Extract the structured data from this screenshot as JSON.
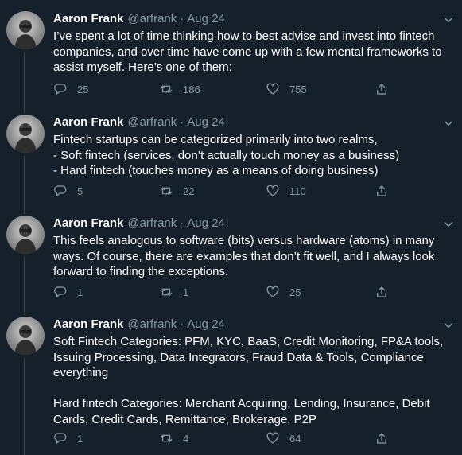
{
  "colors": {
    "background": "#15202b",
    "text": "#ffffff",
    "secondary": "#8899a6",
    "thread_line": "#38444d"
  },
  "tweets": [
    {
      "name": "Aaron Frank",
      "handle": "@arfrank",
      "separator": "·",
      "date": "Aug 24",
      "text": "I’ve spent a lot of time thinking how to best advise and invest into fintech companies, and over time have come up with a few mental frameworks to assist myself.  Here’s one of them:",
      "replies": "25",
      "retweets": "186",
      "likes": "755",
      "icons": [
        "avatar",
        "chevron-down-icon",
        "reply-icon",
        "retweet-icon",
        "like-icon",
        "share-icon"
      ]
    },
    {
      "name": "Aaron Frank",
      "handle": "@arfrank",
      "separator": "·",
      "date": "Aug 24",
      "text": "Fintech startups can be categorized primarily into two realms,\n- Soft fintech (services, don’t actually touch money as a business)\n- Hard fintech (touches money as a means of doing business)",
      "replies": "5",
      "retweets": "22",
      "likes": "110"
    },
    {
      "name": "Aaron Frank",
      "handle": "@arfrank",
      "separator": "·",
      "date": "Aug 24",
      "text": "This feels analogous to software (bits) versus hardware (atoms) in many ways. Of course, there are examples that don’t fit well, and I always look forward to finding the exceptions.",
      "replies": "1",
      "retweets": "1",
      "likes": "25"
    },
    {
      "name": "Aaron Frank",
      "handle": "@arfrank",
      "separator": "·",
      "date": "Aug 24",
      "text": "Soft Fintech Categories: PFM, KYC, BaaS, Credit Monitoring, FP&A tools, Issuing Processing, Data Integrators, Fraud Data & Tools, Compliance everything\n\nHard fintech Categories: Merchant Acquiring, Lending, Insurance, Debit Cards, Credit Cards, Remittance, Brokerage, P2P",
      "replies": "1",
      "retweets": "4",
      "likes": "64"
    }
  ]
}
